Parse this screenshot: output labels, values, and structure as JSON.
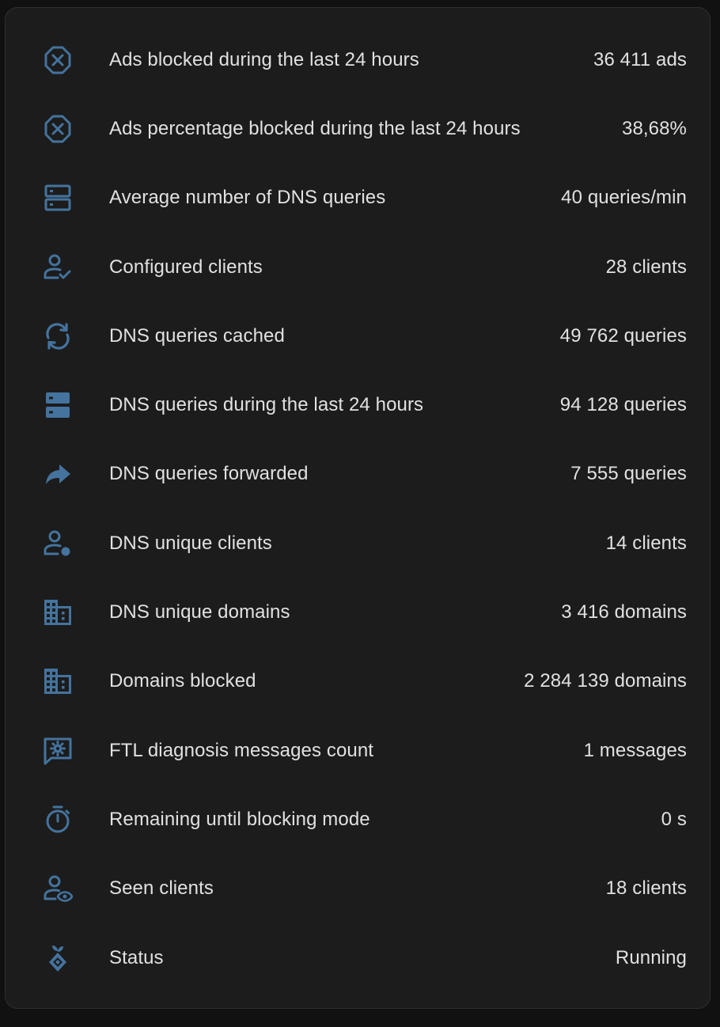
{
  "theme": {
    "background": "#111111",
    "card_background": "#1c1c1c",
    "text_color": "#e1e1e1",
    "icon_color": "#44739e"
  },
  "entities": [
    {
      "icon": "close-octagon-outline-icon",
      "label": "Ads blocked during the last 24 hours",
      "value": "36 411 ads"
    },
    {
      "icon": "close-octagon-outline-icon",
      "label": "Ads percentage blocked during the last 24 hours",
      "value": "38,68%"
    },
    {
      "icon": "server-outline-icon",
      "label": "Average number of DNS queries",
      "value": "40 queries/min"
    },
    {
      "icon": "account-check-outline-icon",
      "label": "Configured clients",
      "value": "28 clients"
    },
    {
      "icon": "sync-icon",
      "label": "DNS queries cached",
      "value": "49 762 queries"
    },
    {
      "icon": "server-icon",
      "label": "DNS queries during the last 24 hours",
      "value": "94 128 queries"
    },
    {
      "icon": "share-forward-icon",
      "label": "DNS queries forwarded",
      "value": "7 555 queries"
    },
    {
      "icon": "account-dot-icon",
      "label": "DNS unique clients",
      "value": "14 clients"
    },
    {
      "icon": "domain-icon",
      "label": "DNS unique domains",
      "value": "3 416 domains"
    },
    {
      "icon": "domain-icon",
      "label": "Domains blocked",
      "value": "2 284 139 domains"
    },
    {
      "icon": "message-cog-icon",
      "label": "FTL diagnosis messages count",
      "value": "1 messages"
    },
    {
      "icon": "timer-outline-icon",
      "label": "Remaining until blocking mode",
      "value": "0 s"
    },
    {
      "icon": "account-eye-outline-icon",
      "label": "Seen clients",
      "value": "18 clients"
    },
    {
      "icon": "pi-hole-icon",
      "label": "Status",
      "value": "Running"
    }
  ]
}
